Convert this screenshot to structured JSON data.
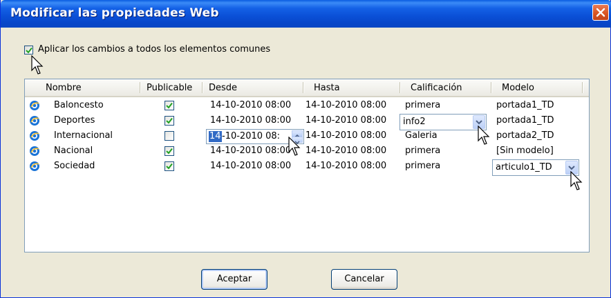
{
  "window": {
    "title": "Modificar las propiedades Web"
  },
  "apply_all": {
    "label": "Aplicar los cambios a todos los elementos comunes",
    "checked": true
  },
  "columns": [
    "Nombre",
    "Publicable",
    "Desde",
    "Hasta",
    "Calificación",
    "Modelo"
  ],
  "rows": [
    {
      "name": "Baloncesto",
      "publicable": true,
      "desde": "14-10-2010 08:00",
      "hasta": "14-10-2010 08:00",
      "calificacion": "primera",
      "modelo": "portada1_TD"
    },
    {
      "name": "Deportes",
      "publicable": true,
      "desde": "14-10-2010 08:00",
      "hasta": "14-10-2010 08:00",
      "calificacion": "info2",
      "modelo": "portada1_TD"
    },
    {
      "name": "Internacional",
      "publicable": false,
      "desde_selected": "14",
      "desde_rest": "-10-2010 08:",
      "hasta": "14-10-2010 08:00",
      "calificacion": "Galeria",
      "modelo": "portada2_TD"
    },
    {
      "name": "Nacional",
      "publicable": true,
      "desde": "14-10-2010 08:00",
      "hasta": "14-10-2010 08:00",
      "calificacion": "primera",
      "modelo": "[Sin modelo]"
    },
    {
      "name": "Sociedad",
      "publicable": true,
      "desde": "14-10-2010 08:00",
      "hasta": "14-10-2010 08:00",
      "calificacion": "primera",
      "modelo": "articulo1_TD"
    }
  ],
  "buttons": {
    "accept": "Aceptar",
    "cancel": "Cancelar"
  },
  "colors": {
    "title_bar": "#0a4fd6",
    "close": "#d9531e",
    "check": "#21a121",
    "selection": "#316ac5",
    "dialog_bg": "#ece9d8"
  },
  "icons": {
    "row_icon": "ie-globe-icon",
    "close": "close-icon",
    "dropdown": "chevron-down-icon",
    "cursor": "mouse-pointer-icon"
  }
}
